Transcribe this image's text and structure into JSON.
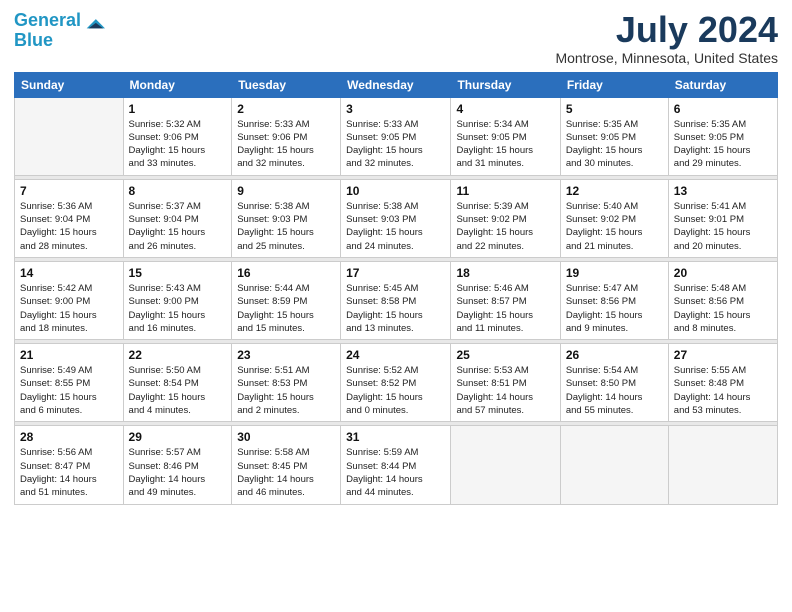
{
  "logo": {
    "line1": "General",
    "line2": "Blue"
  },
  "title": "July 2024",
  "subtitle": "Montrose, Minnesota, United States",
  "days_of_week": [
    "Sunday",
    "Monday",
    "Tuesday",
    "Wednesday",
    "Thursday",
    "Friday",
    "Saturday"
  ],
  "weeks": [
    [
      {
        "num": "",
        "sunrise": "",
        "sunset": "",
        "daylight": ""
      },
      {
        "num": "1",
        "sunrise": "Sunrise: 5:32 AM",
        "sunset": "Sunset: 9:06 PM",
        "daylight": "Daylight: 15 hours and 33 minutes."
      },
      {
        "num": "2",
        "sunrise": "Sunrise: 5:33 AM",
        "sunset": "Sunset: 9:06 PM",
        "daylight": "Daylight: 15 hours and 32 minutes."
      },
      {
        "num": "3",
        "sunrise": "Sunrise: 5:33 AM",
        "sunset": "Sunset: 9:05 PM",
        "daylight": "Daylight: 15 hours and 32 minutes."
      },
      {
        "num": "4",
        "sunrise": "Sunrise: 5:34 AM",
        "sunset": "Sunset: 9:05 PM",
        "daylight": "Daylight: 15 hours and 31 minutes."
      },
      {
        "num": "5",
        "sunrise": "Sunrise: 5:35 AM",
        "sunset": "Sunset: 9:05 PM",
        "daylight": "Daylight: 15 hours and 30 minutes."
      },
      {
        "num": "6",
        "sunrise": "Sunrise: 5:35 AM",
        "sunset": "Sunset: 9:05 PM",
        "daylight": "Daylight: 15 hours and 29 minutes."
      }
    ],
    [
      {
        "num": "7",
        "sunrise": "Sunrise: 5:36 AM",
        "sunset": "Sunset: 9:04 PM",
        "daylight": "Daylight: 15 hours and 28 minutes."
      },
      {
        "num": "8",
        "sunrise": "Sunrise: 5:37 AM",
        "sunset": "Sunset: 9:04 PM",
        "daylight": "Daylight: 15 hours and 26 minutes."
      },
      {
        "num": "9",
        "sunrise": "Sunrise: 5:38 AM",
        "sunset": "Sunset: 9:03 PM",
        "daylight": "Daylight: 15 hours and 25 minutes."
      },
      {
        "num": "10",
        "sunrise": "Sunrise: 5:38 AM",
        "sunset": "Sunset: 9:03 PM",
        "daylight": "Daylight: 15 hours and 24 minutes."
      },
      {
        "num": "11",
        "sunrise": "Sunrise: 5:39 AM",
        "sunset": "Sunset: 9:02 PM",
        "daylight": "Daylight: 15 hours and 22 minutes."
      },
      {
        "num": "12",
        "sunrise": "Sunrise: 5:40 AM",
        "sunset": "Sunset: 9:02 PM",
        "daylight": "Daylight: 15 hours and 21 minutes."
      },
      {
        "num": "13",
        "sunrise": "Sunrise: 5:41 AM",
        "sunset": "Sunset: 9:01 PM",
        "daylight": "Daylight: 15 hours and 20 minutes."
      }
    ],
    [
      {
        "num": "14",
        "sunrise": "Sunrise: 5:42 AM",
        "sunset": "Sunset: 9:00 PM",
        "daylight": "Daylight: 15 hours and 18 minutes."
      },
      {
        "num": "15",
        "sunrise": "Sunrise: 5:43 AM",
        "sunset": "Sunset: 9:00 PM",
        "daylight": "Daylight: 15 hours and 16 minutes."
      },
      {
        "num": "16",
        "sunrise": "Sunrise: 5:44 AM",
        "sunset": "Sunset: 8:59 PM",
        "daylight": "Daylight: 15 hours and 15 minutes."
      },
      {
        "num": "17",
        "sunrise": "Sunrise: 5:45 AM",
        "sunset": "Sunset: 8:58 PM",
        "daylight": "Daylight: 15 hours and 13 minutes."
      },
      {
        "num": "18",
        "sunrise": "Sunrise: 5:46 AM",
        "sunset": "Sunset: 8:57 PM",
        "daylight": "Daylight: 15 hours and 11 minutes."
      },
      {
        "num": "19",
        "sunrise": "Sunrise: 5:47 AM",
        "sunset": "Sunset: 8:56 PM",
        "daylight": "Daylight: 15 hours and 9 minutes."
      },
      {
        "num": "20",
        "sunrise": "Sunrise: 5:48 AM",
        "sunset": "Sunset: 8:56 PM",
        "daylight": "Daylight: 15 hours and 8 minutes."
      }
    ],
    [
      {
        "num": "21",
        "sunrise": "Sunrise: 5:49 AM",
        "sunset": "Sunset: 8:55 PM",
        "daylight": "Daylight: 15 hours and 6 minutes."
      },
      {
        "num": "22",
        "sunrise": "Sunrise: 5:50 AM",
        "sunset": "Sunset: 8:54 PM",
        "daylight": "Daylight: 15 hours and 4 minutes."
      },
      {
        "num": "23",
        "sunrise": "Sunrise: 5:51 AM",
        "sunset": "Sunset: 8:53 PM",
        "daylight": "Daylight: 15 hours and 2 minutes."
      },
      {
        "num": "24",
        "sunrise": "Sunrise: 5:52 AM",
        "sunset": "Sunset: 8:52 PM",
        "daylight": "Daylight: 15 hours and 0 minutes."
      },
      {
        "num": "25",
        "sunrise": "Sunrise: 5:53 AM",
        "sunset": "Sunset: 8:51 PM",
        "daylight": "Daylight: 14 hours and 57 minutes."
      },
      {
        "num": "26",
        "sunrise": "Sunrise: 5:54 AM",
        "sunset": "Sunset: 8:50 PM",
        "daylight": "Daylight: 14 hours and 55 minutes."
      },
      {
        "num": "27",
        "sunrise": "Sunrise: 5:55 AM",
        "sunset": "Sunset: 8:48 PM",
        "daylight": "Daylight: 14 hours and 53 minutes."
      }
    ],
    [
      {
        "num": "28",
        "sunrise": "Sunrise: 5:56 AM",
        "sunset": "Sunset: 8:47 PM",
        "daylight": "Daylight: 14 hours and 51 minutes."
      },
      {
        "num": "29",
        "sunrise": "Sunrise: 5:57 AM",
        "sunset": "Sunset: 8:46 PM",
        "daylight": "Daylight: 14 hours and 49 minutes."
      },
      {
        "num": "30",
        "sunrise": "Sunrise: 5:58 AM",
        "sunset": "Sunset: 8:45 PM",
        "daylight": "Daylight: 14 hours and 46 minutes."
      },
      {
        "num": "31",
        "sunrise": "Sunrise: 5:59 AM",
        "sunset": "Sunset: 8:44 PM",
        "daylight": "Daylight: 14 hours and 44 minutes."
      },
      {
        "num": "",
        "sunrise": "",
        "sunset": "",
        "daylight": ""
      },
      {
        "num": "",
        "sunrise": "",
        "sunset": "",
        "daylight": ""
      },
      {
        "num": "",
        "sunrise": "",
        "sunset": "",
        "daylight": ""
      }
    ]
  ]
}
